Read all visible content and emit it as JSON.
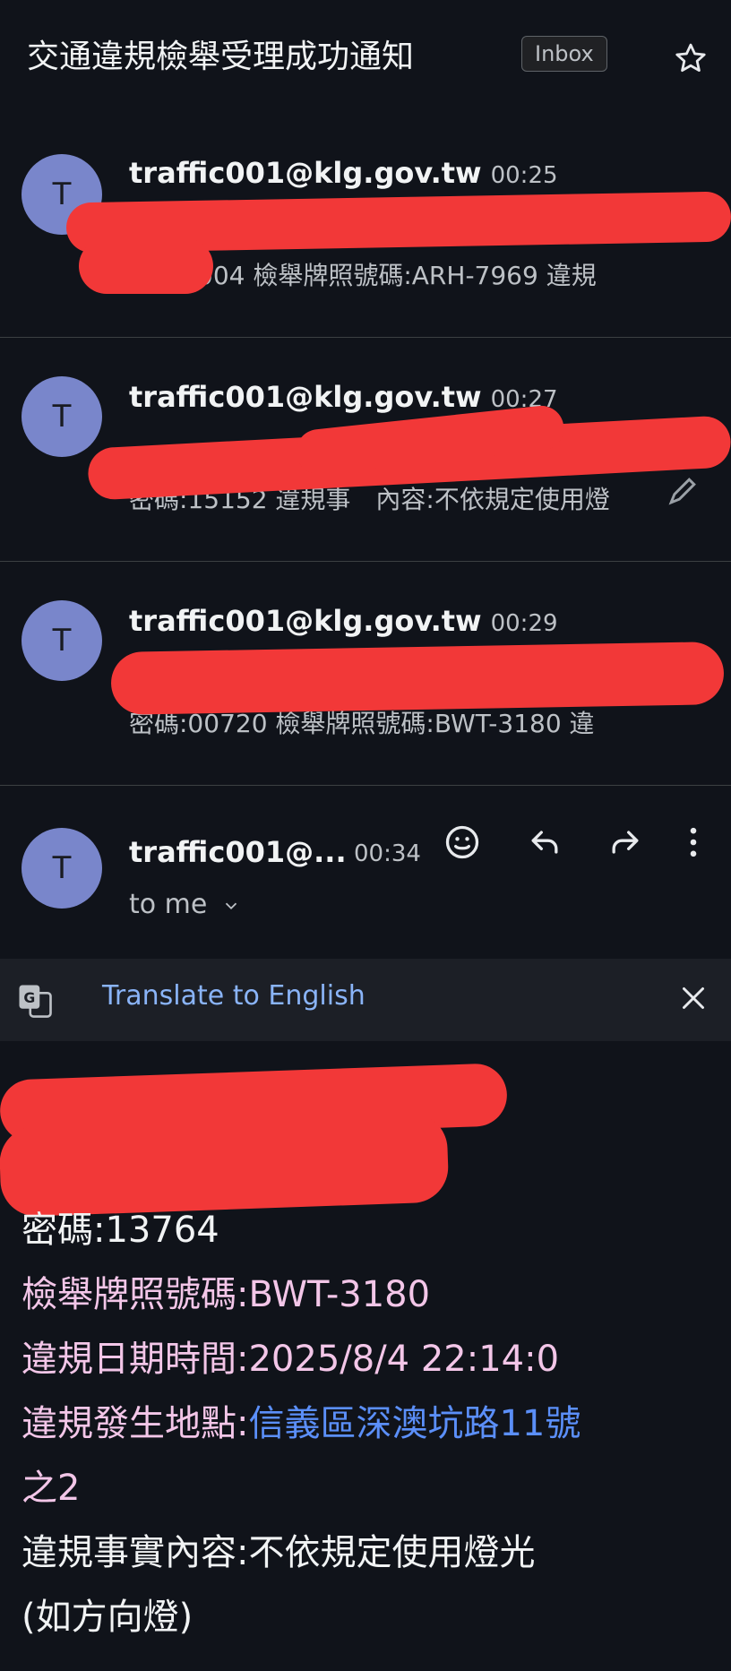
{
  "header": {
    "subject": "交通違規檢舉受理成功通知",
    "badge": "Inbox"
  },
  "messages": [
    {
      "avatar": "T",
      "sender": "traffic001@klg.gov.tw",
      "time": "00:25",
      "snippet": "004 檢舉牌照號碼:ARH-7969 違規"
    },
    {
      "avatar": "T",
      "sender": "traffic001@klg.gov.tw",
      "time": "00:27",
      "snippet": "密碼:15152 違規事　內容:不依規定使用燈"
    },
    {
      "avatar": "T",
      "sender": "traffic001@klg.gov.tw",
      "time": "00:29",
      "snippet": "密碼:00720 檢舉牌照號碼:BWT-3180 違"
    }
  ],
  "expanded": {
    "avatar": "T",
    "sender": "traffic001@...",
    "time": "00:34",
    "recipient": "to me"
  },
  "translate": {
    "label": "Translate to English"
  },
  "body": {
    "password": "密碼:13764",
    "plate_label": "檢舉牌照號碼:",
    "plate": "BWT-3180",
    "datetime_label": "違規日期時間:",
    "datetime": "2025/8/4 22:14:0",
    "location_label": "違規發生地點:",
    "location_link": "信義區深澳坑路11號",
    "location_cont": "之2",
    "fact_line1": "違規事實內容:不依規定使用燈光",
    "fact_line2": "(如方向燈)"
  },
  "icons": {
    "star": "star-icon",
    "emoji": "emoji-icon",
    "reply": "reply-icon",
    "forward": "forward-icon",
    "more": "more-vert-icon",
    "translate": "google-translate-icon",
    "close": "close-icon",
    "chevron": "chevron-down-icon"
  },
  "colors": {
    "background": "#10131a",
    "avatar": "#7986cb",
    "redaction": "#f23838",
    "link": "#8ab4f8"
  }
}
